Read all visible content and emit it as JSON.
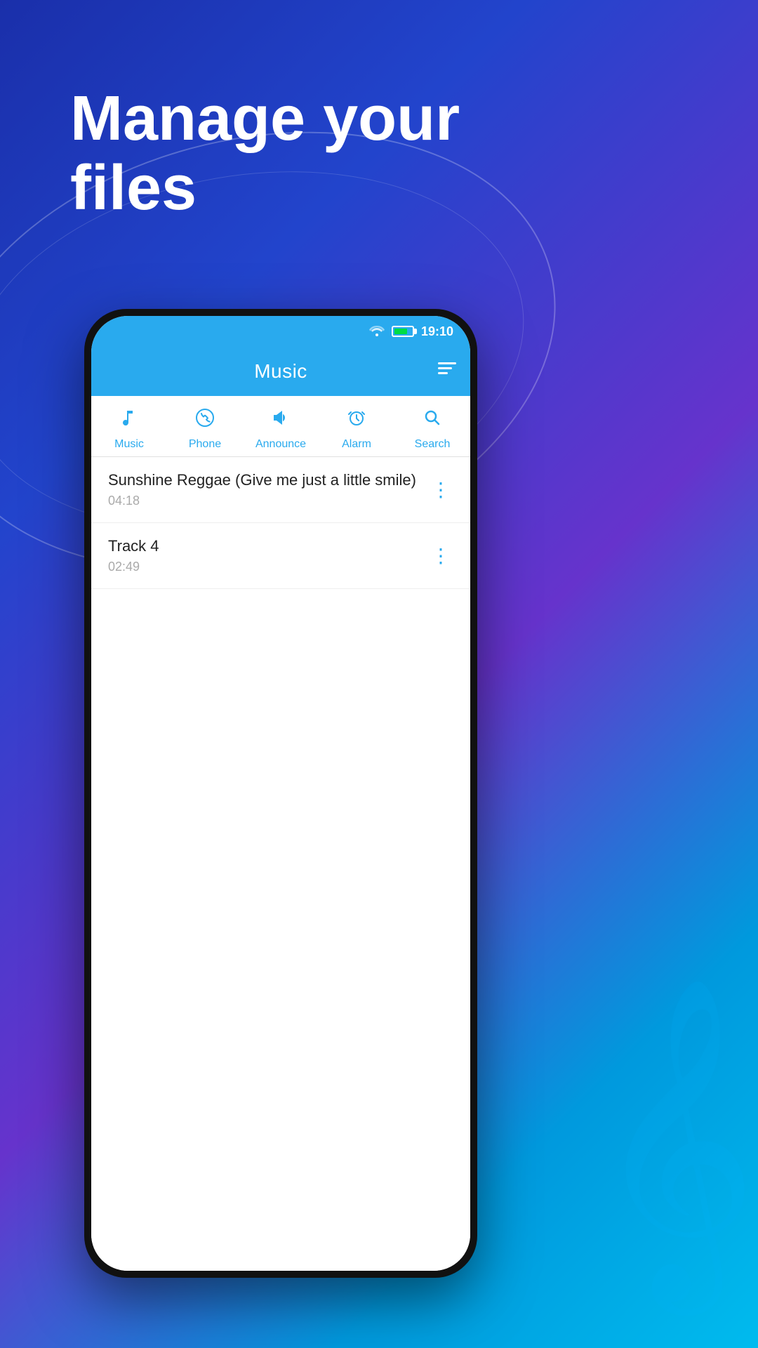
{
  "background": {
    "headline_line1": "Manage your",
    "headline_line2": "files"
  },
  "status_bar": {
    "time": "19:10",
    "wifi_icon": "wifi-icon",
    "battery_icon": "battery-icon"
  },
  "app_header": {
    "title": "Music",
    "sort_icon": "sort-icon"
  },
  "tabs": [
    {
      "id": "music",
      "label": "Music",
      "icon": "♪"
    },
    {
      "id": "phone",
      "label": "Phone",
      "icon": "📞"
    },
    {
      "id": "announce",
      "label": "Announce",
      "icon": "📢"
    },
    {
      "id": "alarm",
      "label": "Alarm",
      "icon": "⏰"
    },
    {
      "id": "search",
      "label": "Search",
      "icon": "🔍"
    }
  ],
  "tracks": [
    {
      "title": "Sunshine Reggae (Give me just a little smile)",
      "duration": "04:18"
    },
    {
      "title": "Track 4",
      "duration": "02:49"
    }
  ]
}
